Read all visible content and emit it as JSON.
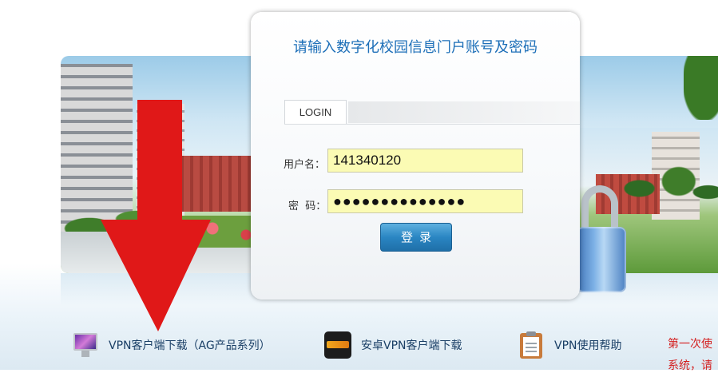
{
  "login": {
    "title": "请输入数字化校园信息门户账号及密码",
    "tab_label": "LOGIN",
    "username_label": "用户名：",
    "username_value": "141340120",
    "password_label": "密  码：",
    "password_masked": "●●●●●●●●●●●●●●",
    "submit_label": "登录"
  },
  "links": {
    "vpn_client": "VPN客户端下载（AG产品系列）",
    "android_vpn": "安卓VPN客户端下载",
    "vpn_help": "VPN使用帮助"
  },
  "notice": {
    "line1": "第一次使",
    "line2": "系统，请"
  },
  "icons": {
    "vpn_client": "monitor-icon",
    "android_vpn": "android-app-icon",
    "vpn_help": "clipboard-icon",
    "lock": "padlock-icon",
    "arrow": "down-arrow-icon"
  },
  "colors": {
    "title": "#1d6fb8",
    "button": "#2a86c3",
    "input_bg": "#fbfbb4",
    "notice": "#d42020",
    "arrow": "#e01818"
  }
}
